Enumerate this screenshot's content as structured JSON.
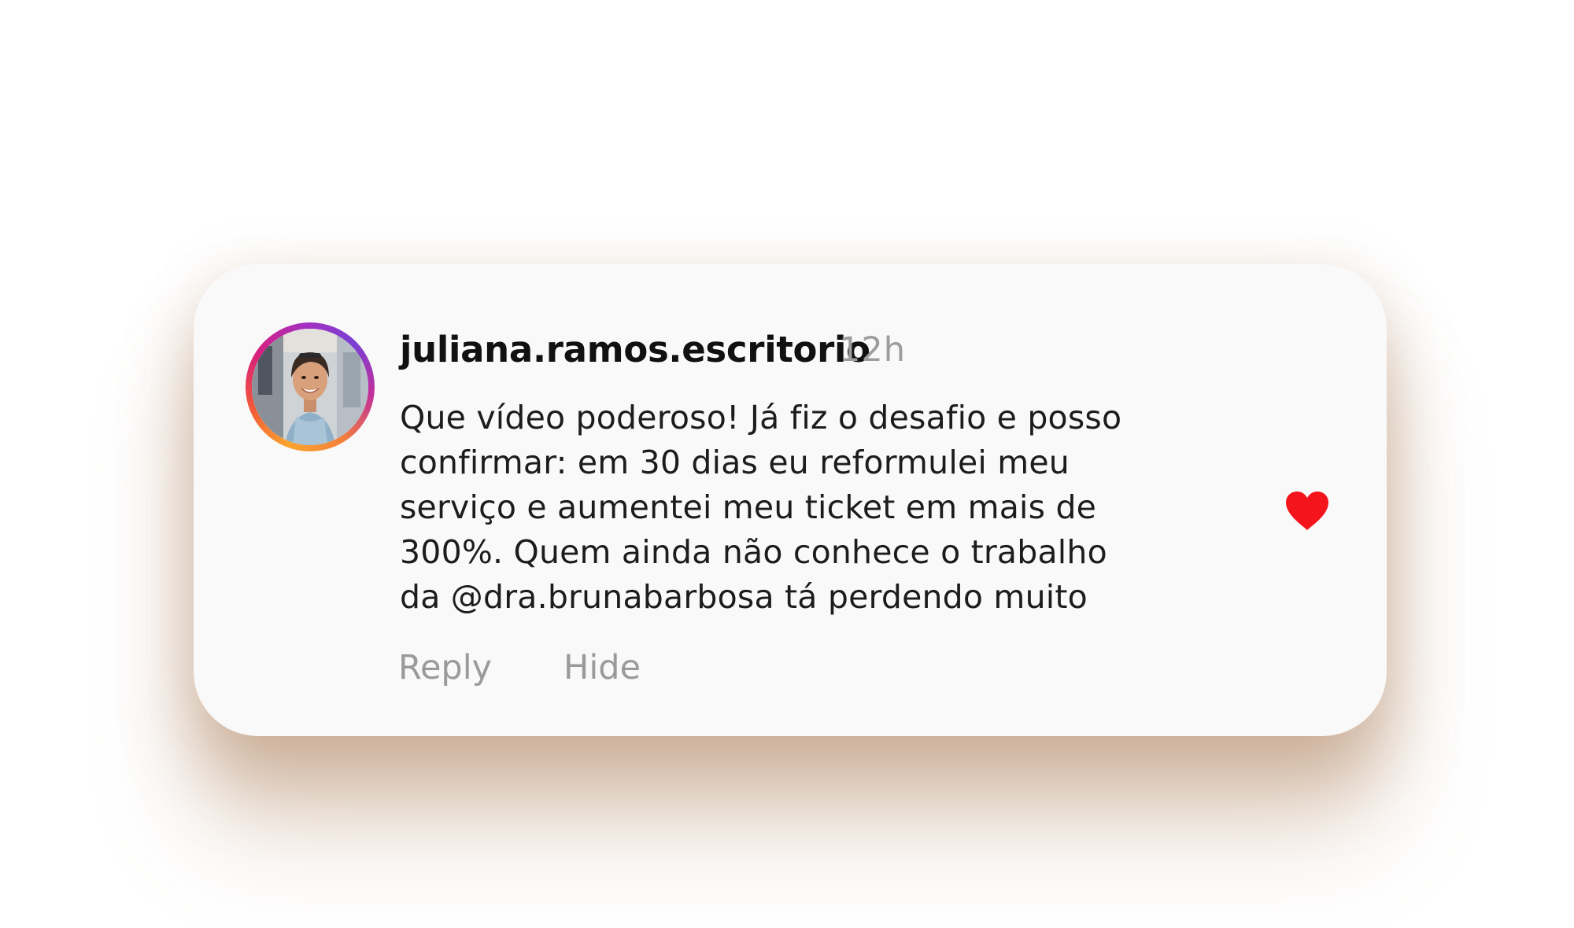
{
  "comment": {
    "username": "juliana.ramos.escritorio",
    "time": "12h",
    "text_lines": [
      "Que vídeo poderoso! Já fiz o desafio e posso",
      "confirmar: em 30 dias eu reformulei meu",
      "serviço e aumentei meu ticket em mais de",
      "300%. Quem ainda não conhece o trabalho",
      "da @dra.brunabarbosa tá perdendo muito"
    ],
    "actions": {
      "reply_label": "Reply",
      "hide_label": "Hide"
    },
    "liked": true,
    "avatar_icon": "profile-photo-with-story-ring",
    "like_icon": "heart-filled"
  },
  "colors": {
    "card_background": "#faf9f9",
    "username": "#111111",
    "secondary_text": "#9d9d9d",
    "heart": "#f3141c",
    "ring_gradient": [
      "#f9a52d",
      "#f2563a",
      "#d81f7d",
      "#a52fc1",
      "#7a3fd4"
    ]
  }
}
